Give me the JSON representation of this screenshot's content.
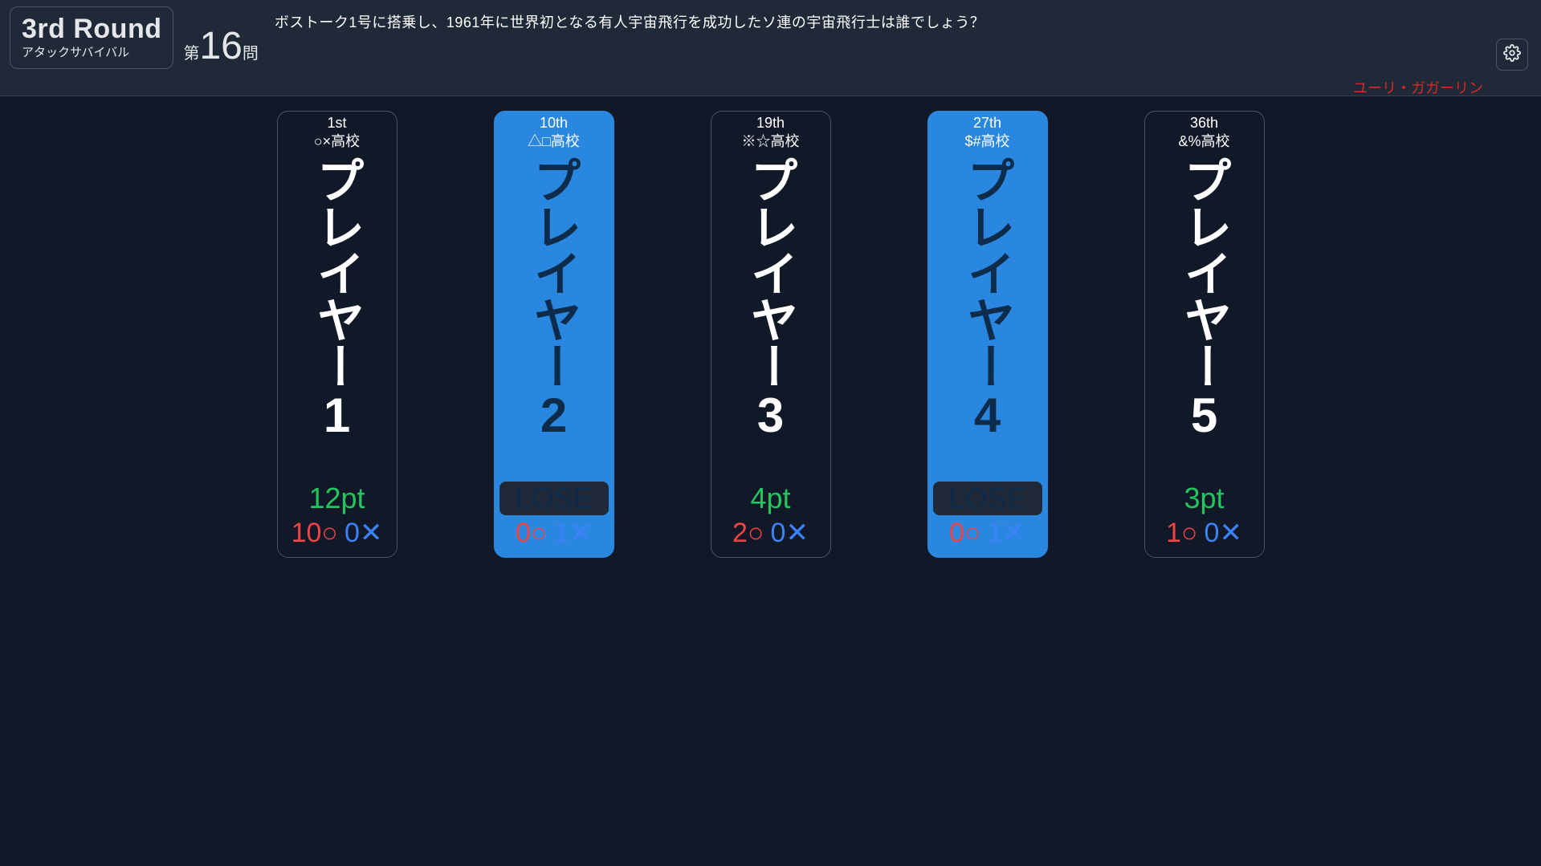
{
  "header": {
    "round_title": "3rd Round",
    "round_sub": "アタックサバイバル",
    "q_prefix": "第",
    "q_number": "16",
    "q_suffix": "問",
    "question": "ボストーク1号に搭乗し、1961年に世界初となる有人宇宙飛行を成功したソ連の宇宙飛行士は誰でしょう？",
    "answer": "ユーリ・ガガーリン"
  },
  "icons": {
    "settings": "gear-icon"
  },
  "symbols": {
    "circle": "○",
    "cross": "✕"
  },
  "players": [
    {
      "rank": "1st",
      "school": "○×高校",
      "name": "プレイヤー1",
      "status": "pt",
      "score_text": "12pt",
      "o": "10",
      "x": "0"
    },
    {
      "rank": "10th",
      "school": "△□高校",
      "name": "プレイヤー2",
      "status": "lose",
      "score_text": "LOSE",
      "o": "0",
      "x": "1"
    },
    {
      "rank": "19th",
      "school": "※☆高校",
      "name": "プレイヤー3",
      "status": "pt",
      "score_text": "4pt",
      "o": "2",
      "x": "0"
    },
    {
      "rank": "27th",
      "school": "$#高校",
      "name": "プレイヤー4",
      "status": "lose",
      "score_text": "LOSE",
      "o": "0",
      "x": "1"
    },
    {
      "rank": "36th",
      "school": "&%高校",
      "name": "プレイヤー5",
      "status": "pt",
      "score_text": "3pt",
      "o": "1",
      "x": "0"
    }
  ]
}
